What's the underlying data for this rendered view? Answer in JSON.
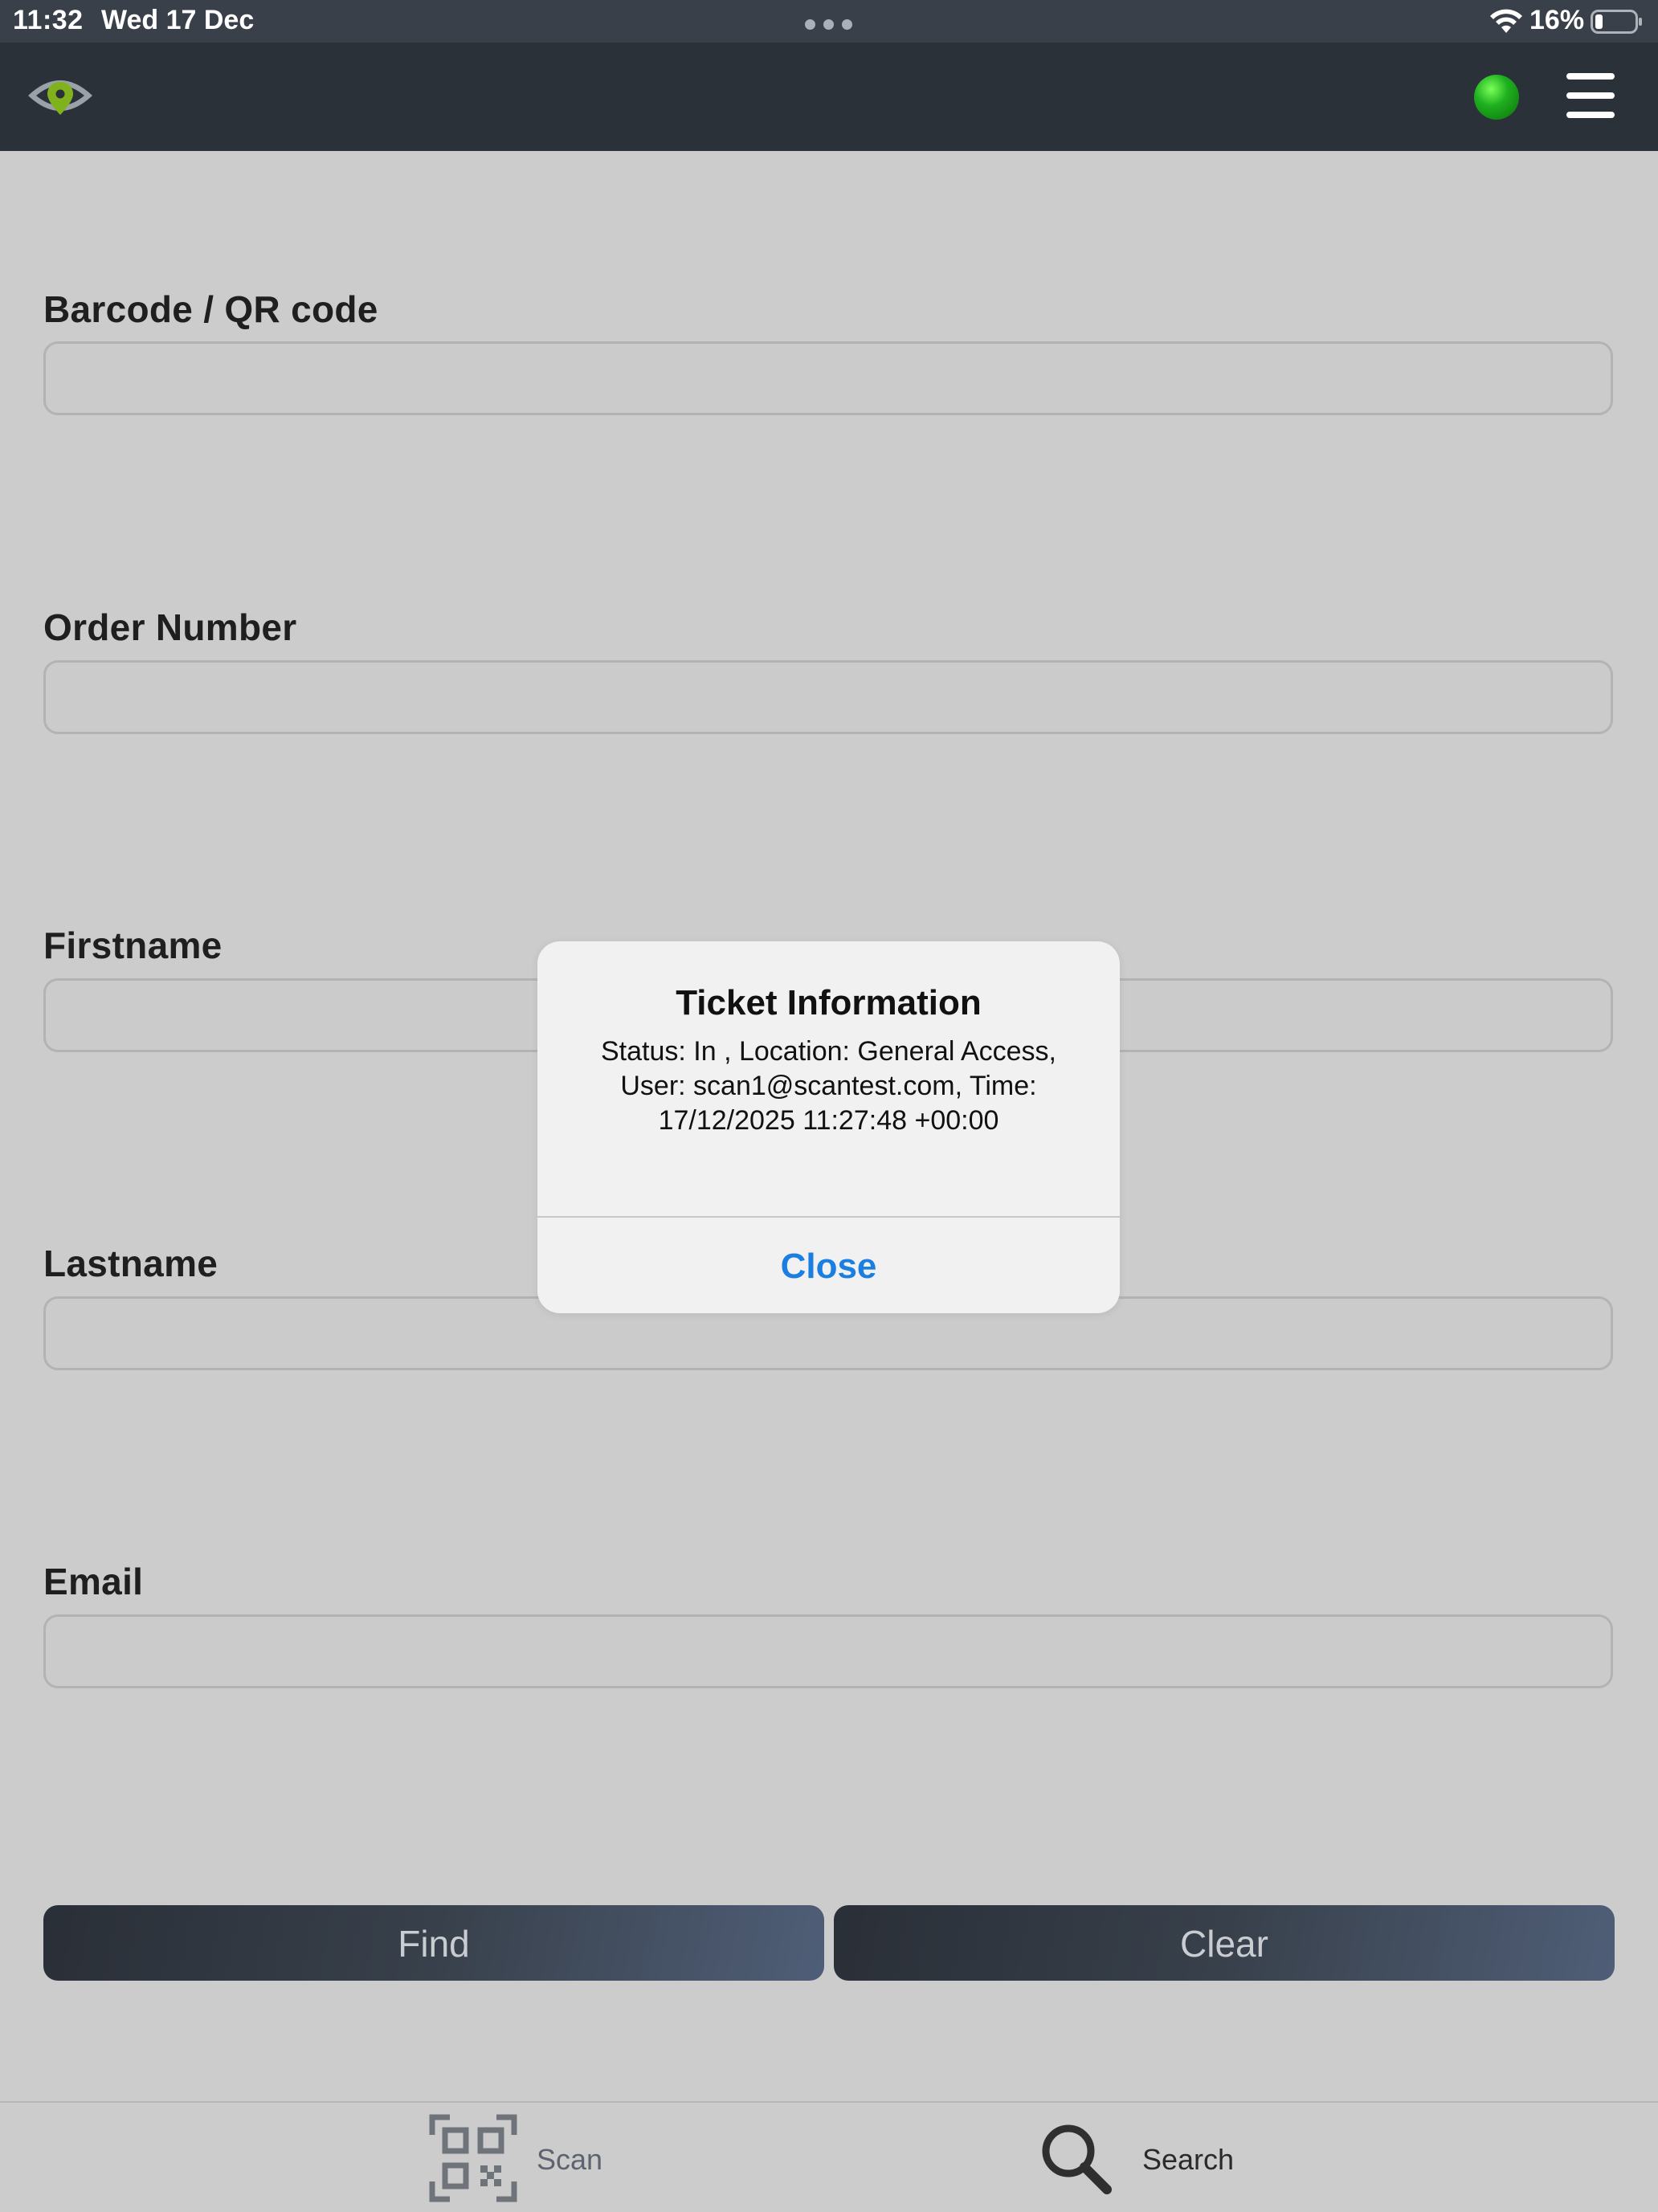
{
  "status_bar": {
    "time": "11:32",
    "date": "Wed 17 Dec",
    "battery_percent": "16%",
    "battery_level": 0.16
  },
  "top_bar": {
    "logo_icon": "eye-location-pin-icon",
    "connection_status_color": "#1fb01f",
    "menu_icon": "hamburger-menu-icon"
  },
  "form": {
    "barcode": {
      "label": "Barcode / QR code",
      "value": ""
    },
    "order_number": {
      "label": "Order Number",
      "value": ""
    },
    "firstname": {
      "label": "Firstname",
      "value": ""
    },
    "lastname": {
      "label": "Lastname",
      "value": ""
    },
    "email": {
      "label": "Email",
      "value": ""
    }
  },
  "actions": {
    "find_label": "Find",
    "clear_label": "Clear"
  },
  "tab_bar": {
    "scan_label": "Scan",
    "scan_icon": "qr-code-icon",
    "search_label": "Search",
    "search_icon": "magnifier-icon"
  },
  "dialog": {
    "title": "Ticket Information",
    "message_line1": "Status: In , Location: General Access,",
    "message_line2": "User: scan1@scantest.com, Time:",
    "message_line3": "17/12/2025 11:27:48 +00:00",
    "close_label": "Close",
    "accent_color": "#1a7fe0"
  }
}
